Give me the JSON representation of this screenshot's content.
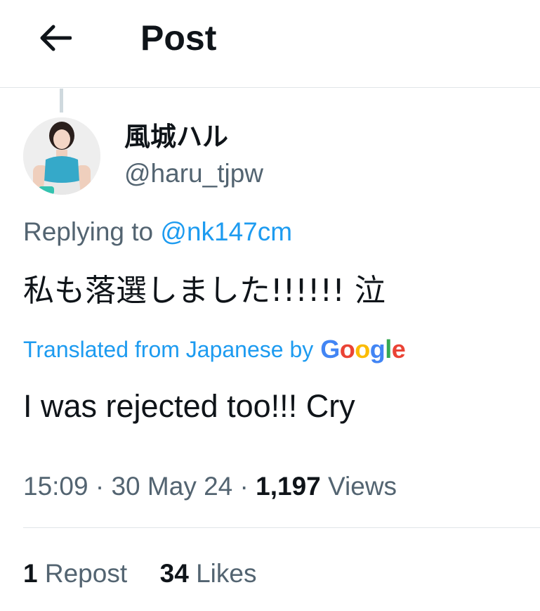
{
  "header": {
    "title": "Post",
    "back_icon": "arrow-left-icon"
  },
  "author": {
    "display_name": "風城ハル",
    "handle": "@haru_tjpw"
  },
  "reply": {
    "prefix": "Replying to",
    "mention": "@nk147cm"
  },
  "post": {
    "text": "私も落選しました!!!!!!  泣",
    "translated_label": "Translated from Japanese by",
    "translator_logo": "Google",
    "translation": "I was rejected too!!! Cry"
  },
  "meta": {
    "time": "15:09",
    "sep1": "·",
    "date": "30 May 24",
    "sep2": "·",
    "views_count": "1,197",
    "views_label": "Views"
  },
  "stats": {
    "reposts_count": "1",
    "reposts_label": "Repost",
    "likes_count": "34",
    "likes_label": "Likes"
  },
  "colors": {
    "link": "#1d9bf0",
    "secondary_text": "#536471",
    "primary_text": "#0f1419"
  }
}
